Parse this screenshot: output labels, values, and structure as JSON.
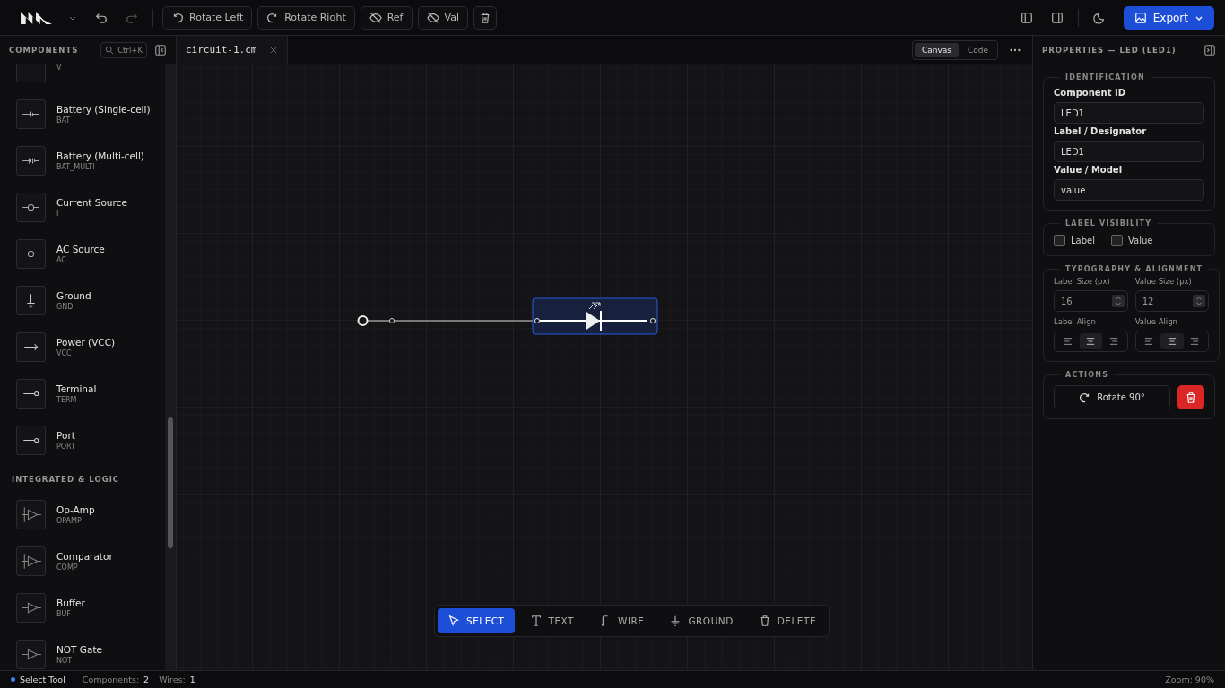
{
  "toolbar": {
    "buttons": [
      {
        "label": "Rotate Left",
        "kind": "rotate-left"
      },
      {
        "label": "Rotate Right",
        "kind": "rotate-right"
      },
      {
        "label": "Ref",
        "kind": "hide"
      },
      {
        "label": "Val",
        "kind": "hide"
      }
    ],
    "export": "Export"
  },
  "sidebar": {
    "title": "COMPONENTS",
    "search_hint": "Ctrl+K",
    "sections": [
      {
        "items": [
          {
            "code": "V"
          },
          {
            "name": "Battery (Single-cell)",
            "code": "BAT"
          },
          {
            "name": "Battery (Multi-cell)",
            "code": "BAT_MULTI"
          },
          {
            "name": "Current Source",
            "code": "I"
          },
          {
            "name": "AC Source",
            "code": "AC"
          },
          {
            "name": "Ground",
            "code": "GND"
          },
          {
            "name": "Power (VCC)",
            "code": "VCC"
          },
          {
            "name": "Terminal",
            "code": "TERM"
          },
          {
            "name": "Port",
            "code": "PORT"
          }
        ]
      },
      {
        "title": "INTEGRATED & LOGIC",
        "items": [
          {
            "name": "Op-Amp",
            "code": "OPAMP"
          },
          {
            "name": "Comparator",
            "code": "COMP"
          },
          {
            "name": "Buffer",
            "code": "BUF"
          },
          {
            "name": "NOT Gate",
            "code": "NOT"
          }
        ]
      }
    ]
  },
  "tabs": [
    {
      "label": "circuit-1.cm",
      "selected": true
    }
  ],
  "view_modes": [
    {
      "label": "Canvas",
      "selected": true
    },
    {
      "label": "Code",
      "selected": false
    }
  ],
  "tools": [
    {
      "label": "SELECT",
      "kind": "select",
      "selected": true
    },
    {
      "label": "TEXT",
      "kind": "text",
      "selected": false
    },
    {
      "label": "WIRE",
      "kind": "wire",
      "selected": false
    },
    {
      "label": "GROUND",
      "kind": "ground",
      "selected": false
    },
    {
      "label": "DELETE",
      "kind": "delete",
      "selected": false
    }
  ],
  "properties": {
    "title": "PROPERTIES — LED (LED1)",
    "identification": {
      "title": "IDENTIFICATION",
      "fields": [
        {
          "label": "Component ID",
          "value": "LED1"
        },
        {
          "label": "Label / Designator",
          "value": "LED1"
        },
        {
          "label": "Value / Model",
          "value": "value"
        }
      ]
    },
    "visibility": {
      "title": "LABEL VISIBILITY",
      "checks": [
        {
          "label": "Label",
          "checked": false
        },
        {
          "label": "Value",
          "checked": false
        }
      ]
    },
    "typography": {
      "title": "TYPOGRAPHY & ALIGNMENT",
      "sizes": [
        {
          "label": "Label Size (px)",
          "value": "16"
        },
        {
          "label": "Value Size (px)",
          "value": "12"
        }
      ],
      "aligns": [
        {
          "label": "Label Align",
          "options": [
            {
              "kind": "left",
              "selected": false
            },
            {
              "kind": "center",
              "selected": true
            },
            {
              "kind": "right",
              "selected": false
            }
          ]
        },
        {
          "label": "Value Align",
          "options": [
            {
              "kind": "left",
              "selected": false
            },
            {
              "kind": "center",
              "selected": true
            },
            {
              "kind": "right",
              "selected": false
            }
          ]
        }
      ]
    },
    "actions": {
      "title": "ACTIONS",
      "rotate": "Rotate 90°"
    }
  },
  "status_bar": {
    "tool": "Select Tool",
    "components_label": "Components:",
    "components": "2",
    "wires_label": "Wires:",
    "wires": "1",
    "zoom": "Zoom: 90%"
  }
}
